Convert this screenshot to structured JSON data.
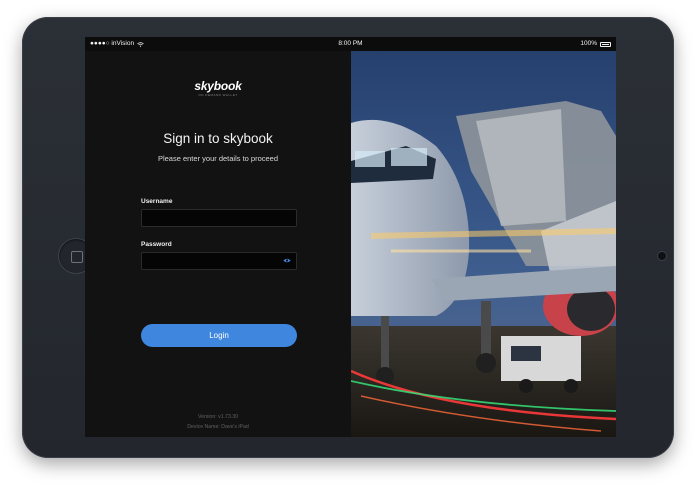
{
  "statusbar": {
    "carrier": "●●●●○ inVision",
    "time": "8:00 PM",
    "battery": "100%"
  },
  "brand": {
    "name": "skybook",
    "tagline": "ON DEMAND WALLET"
  },
  "login": {
    "title": "Sign in to skybook",
    "subtitle": "Please enter your details to proceed",
    "username_label": "Username",
    "username_value": "",
    "password_label": "Password",
    "password_value": "",
    "login_button": "Login"
  },
  "footer": {
    "version": "Version: v1.73.30",
    "device": "Device Name: Dave's iPad"
  },
  "colors": {
    "accent": "#3f86de",
    "background": "#121213"
  },
  "icons": {
    "wifi": "wifi-icon",
    "battery": "battery-icon",
    "show_password": "eye-icon",
    "home_button": "home-button-icon"
  }
}
